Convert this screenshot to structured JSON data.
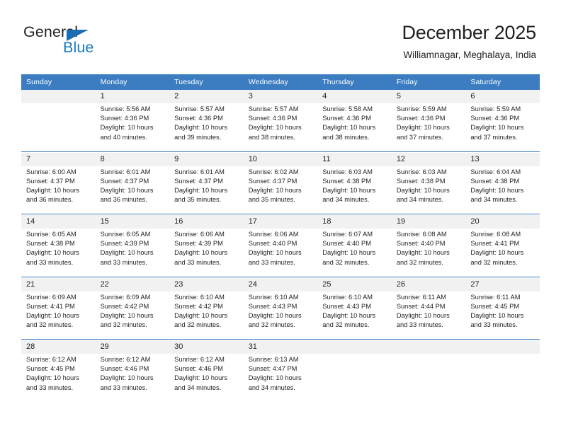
{
  "brand": {
    "word_general": "General",
    "word_blue": "Blue",
    "triangle_color": "#1a6cb5",
    "blue_color": "#1a7ac4"
  },
  "header": {
    "title": "December 2025",
    "subtitle": "Williamnagar, Meghalaya, India"
  },
  "theme": {
    "header_blue": "#3b7dc0",
    "daynum_band": "#f1f1f1",
    "text": "#231f20"
  },
  "weekdays": [
    "Sunday",
    "Monday",
    "Tuesday",
    "Wednesday",
    "Thursday",
    "Friday",
    "Saturday"
  ],
  "weeks": [
    {
      "days": [
        {
          "num": "",
          "sunrise": "",
          "sunset": "",
          "daylight1": "",
          "daylight2": ""
        },
        {
          "num": "1",
          "sunrise": "Sunrise: 5:56 AM",
          "sunset": "Sunset: 4:36 PM",
          "daylight1": "Daylight: 10 hours",
          "daylight2": "and 40 minutes."
        },
        {
          "num": "2",
          "sunrise": "Sunrise: 5:57 AM",
          "sunset": "Sunset: 4:36 PM",
          "daylight1": "Daylight: 10 hours",
          "daylight2": "and 39 minutes."
        },
        {
          "num": "3",
          "sunrise": "Sunrise: 5:57 AM",
          "sunset": "Sunset: 4:36 PM",
          "daylight1": "Daylight: 10 hours",
          "daylight2": "and 38 minutes."
        },
        {
          "num": "4",
          "sunrise": "Sunrise: 5:58 AM",
          "sunset": "Sunset: 4:36 PM",
          "daylight1": "Daylight: 10 hours",
          "daylight2": "and 38 minutes."
        },
        {
          "num": "5",
          "sunrise": "Sunrise: 5:59 AM",
          "sunset": "Sunset: 4:36 PM",
          "daylight1": "Daylight: 10 hours",
          "daylight2": "and 37 minutes."
        },
        {
          "num": "6",
          "sunrise": "Sunrise: 5:59 AM",
          "sunset": "Sunset: 4:36 PM",
          "daylight1": "Daylight: 10 hours",
          "daylight2": "and 37 minutes."
        }
      ]
    },
    {
      "days": [
        {
          "num": "7",
          "sunrise": "Sunrise: 6:00 AM",
          "sunset": "Sunset: 4:37 PM",
          "daylight1": "Daylight: 10 hours",
          "daylight2": "and 36 minutes."
        },
        {
          "num": "8",
          "sunrise": "Sunrise: 6:01 AM",
          "sunset": "Sunset: 4:37 PM",
          "daylight1": "Daylight: 10 hours",
          "daylight2": "and 36 minutes."
        },
        {
          "num": "9",
          "sunrise": "Sunrise: 6:01 AM",
          "sunset": "Sunset: 4:37 PM",
          "daylight1": "Daylight: 10 hours",
          "daylight2": "and 35 minutes."
        },
        {
          "num": "10",
          "sunrise": "Sunrise: 6:02 AM",
          "sunset": "Sunset: 4:37 PM",
          "daylight1": "Daylight: 10 hours",
          "daylight2": "and 35 minutes."
        },
        {
          "num": "11",
          "sunrise": "Sunrise: 6:03 AM",
          "sunset": "Sunset: 4:38 PM",
          "daylight1": "Daylight: 10 hours",
          "daylight2": "and 34 minutes."
        },
        {
          "num": "12",
          "sunrise": "Sunrise: 6:03 AM",
          "sunset": "Sunset: 4:38 PM",
          "daylight1": "Daylight: 10 hours",
          "daylight2": "and 34 minutes."
        },
        {
          "num": "13",
          "sunrise": "Sunrise: 6:04 AM",
          "sunset": "Sunset: 4:38 PM",
          "daylight1": "Daylight: 10 hours",
          "daylight2": "and 34 minutes."
        }
      ]
    },
    {
      "days": [
        {
          "num": "14",
          "sunrise": "Sunrise: 6:05 AM",
          "sunset": "Sunset: 4:38 PM",
          "daylight1": "Daylight: 10 hours",
          "daylight2": "and 33 minutes."
        },
        {
          "num": "15",
          "sunrise": "Sunrise: 6:05 AM",
          "sunset": "Sunset: 4:39 PM",
          "daylight1": "Daylight: 10 hours",
          "daylight2": "and 33 minutes."
        },
        {
          "num": "16",
          "sunrise": "Sunrise: 6:06 AM",
          "sunset": "Sunset: 4:39 PM",
          "daylight1": "Daylight: 10 hours",
          "daylight2": "and 33 minutes."
        },
        {
          "num": "17",
          "sunrise": "Sunrise: 6:06 AM",
          "sunset": "Sunset: 4:40 PM",
          "daylight1": "Daylight: 10 hours",
          "daylight2": "and 33 minutes."
        },
        {
          "num": "18",
          "sunrise": "Sunrise: 6:07 AM",
          "sunset": "Sunset: 4:40 PM",
          "daylight1": "Daylight: 10 hours",
          "daylight2": "and 32 minutes."
        },
        {
          "num": "19",
          "sunrise": "Sunrise: 6:08 AM",
          "sunset": "Sunset: 4:40 PM",
          "daylight1": "Daylight: 10 hours",
          "daylight2": "and 32 minutes."
        },
        {
          "num": "20",
          "sunrise": "Sunrise: 6:08 AM",
          "sunset": "Sunset: 4:41 PM",
          "daylight1": "Daylight: 10 hours",
          "daylight2": "and 32 minutes."
        }
      ]
    },
    {
      "days": [
        {
          "num": "21",
          "sunrise": "Sunrise: 6:09 AM",
          "sunset": "Sunset: 4:41 PM",
          "daylight1": "Daylight: 10 hours",
          "daylight2": "and 32 minutes."
        },
        {
          "num": "22",
          "sunrise": "Sunrise: 6:09 AM",
          "sunset": "Sunset: 4:42 PM",
          "daylight1": "Daylight: 10 hours",
          "daylight2": "and 32 minutes."
        },
        {
          "num": "23",
          "sunrise": "Sunrise: 6:10 AM",
          "sunset": "Sunset: 4:42 PM",
          "daylight1": "Daylight: 10 hours",
          "daylight2": "and 32 minutes."
        },
        {
          "num": "24",
          "sunrise": "Sunrise: 6:10 AM",
          "sunset": "Sunset: 4:43 PM",
          "daylight1": "Daylight: 10 hours",
          "daylight2": "and 32 minutes."
        },
        {
          "num": "25",
          "sunrise": "Sunrise: 6:10 AM",
          "sunset": "Sunset: 4:43 PM",
          "daylight1": "Daylight: 10 hours",
          "daylight2": "and 32 minutes."
        },
        {
          "num": "26",
          "sunrise": "Sunrise: 6:11 AM",
          "sunset": "Sunset: 4:44 PM",
          "daylight1": "Daylight: 10 hours",
          "daylight2": "and 33 minutes."
        },
        {
          "num": "27",
          "sunrise": "Sunrise: 6:11 AM",
          "sunset": "Sunset: 4:45 PM",
          "daylight1": "Daylight: 10 hours",
          "daylight2": "and 33 minutes."
        }
      ]
    },
    {
      "days": [
        {
          "num": "28",
          "sunrise": "Sunrise: 6:12 AM",
          "sunset": "Sunset: 4:45 PM",
          "daylight1": "Daylight: 10 hours",
          "daylight2": "and 33 minutes."
        },
        {
          "num": "29",
          "sunrise": "Sunrise: 6:12 AM",
          "sunset": "Sunset: 4:46 PM",
          "daylight1": "Daylight: 10 hours",
          "daylight2": "and 33 minutes."
        },
        {
          "num": "30",
          "sunrise": "Sunrise: 6:12 AM",
          "sunset": "Sunset: 4:46 PM",
          "daylight1": "Daylight: 10 hours",
          "daylight2": "and 34 minutes."
        },
        {
          "num": "31",
          "sunrise": "Sunrise: 6:13 AM",
          "sunset": "Sunset: 4:47 PM",
          "daylight1": "Daylight: 10 hours",
          "daylight2": "and 34 minutes."
        },
        {
          "num": "",
          "sunrise": "",
          "sunset": "",
          "daylight1": "",
          "daylight2": ""
        },
        {
          "num": "",
          "sunrise": "",
          "sunset": "",
          "daylight1": "",
          "daylight2": ""
        },
        {
          "num": "",
          "sunrise": "",
          "sunset": "",
          "daylight1": "",
          "daylight2": ""
        }
      ]
    }
  ]
}
